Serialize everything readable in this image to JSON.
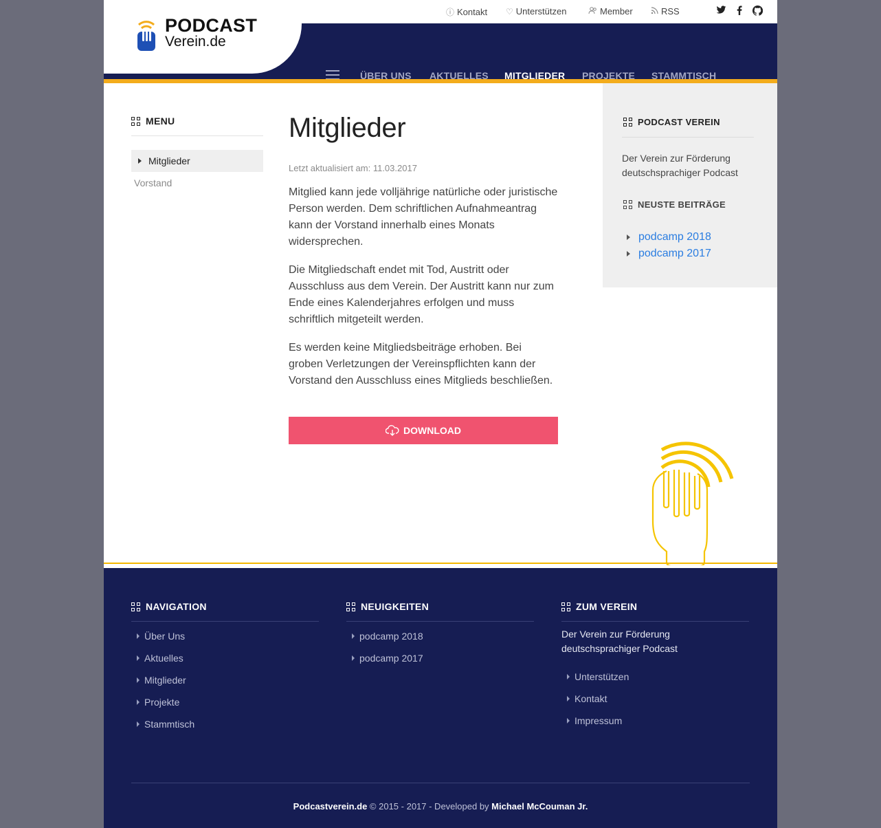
{
  "logo": {
    "title": "PODCAST",
    "subtitle": "Verein.de"
  },
  "topbar": {
    "links": [
      {
        "label": "Kontakt",
        "icon": "question-circle-icon"
      },
      {
        "label": "Unterstützen",
        "icon": "heart-icon"
      },
      {
        "label": "Member",
        "icon": "users-icon"
      },
      {
        "label": "RSS",
        "icon": "rss-icon"
      }
    ],
    "social": [
      "twitter-icon",
      "facebook-icon",
      "github-icon"
    ]
  },
  "nav": {
    "items": [
      "ÜBER UNS",
      "AKTUELLES",
      "MITGLIEDER",
      "PROJEKTE",
      "STAMMTISCH"
    ],
    "active": "MITGLIEDER"
  },
  "left_menu": {
    "title": "MENU",
    "items": [
      "Mitglieder",
      "Vorstand"
    ]
  },
  "main": {
    "title": "Mitglieder",
    "updated": "Letzt aktualisiert am: 11.03.2017",
    "paragraphs": [
      "Mitglied kann jede volljährige natürliche oder juristi­sche Person werden. Dem schriftlichen Aufnahme­antrag kann der Vorstand innerhalb eines Monats widersprechen.",
      "Die Mitgliedschaft endet mit Tod, Austritt oder Ausschluss aus dem Verein. Der Austritt kann nur zum Ende eines Kalenderjahres erfolgen und muss schriftlich mitgeteilt werden.",
      "Es werden keine Mitgliedsbeiträge erhoben. Bei groben Verletzungen der Vereinspflichten kann der Vorstand den Ausschluss eines Mitglieds beschließen."
    ],
    "download_label": "DOWNLOAD"
  },
  "sidebar": {
    "verein_title": "PODCAST VEREIN",
    "verein_desc": "Der Verein zur Förderung deutschsprachiger Podcast",
    "posts_title": "NEUSTE BEITRÄGE",
    "posts": [
      "podcamp 2018",
      "podcamp 2017"
    ]
  },
  "footer": {
    "navigation": {
      "title": "NAVIGATION",
      "links": [
        "Über Uns",
        "Aktuelles",
        "Mitglieder",
        "Projekte",
        "Stammtisch"
      ]
    },
    "news": {
      "title": "NEUIGKEITEN",
      "links": [
        "podcamp 2018",
        "podcamp 2017"
      ]
    },
    "verein": {
      "title": "ZUM VEREIN",
      "desc": "Der Verein zur Förderung deutschsprachiger Podcast",
      "links": [
        "Unterstützen",
        "Kontakt",
        "Impressum"
      ]
    },
    "copyright": {
      "site": "Podcastverein.de",
      "middle": " © 2015 - 2017 - Developed by ",
      "author": "Michael McCouman Jr."
    }
  },
  "colors": {
    "navy": "#161d53",
    "accent": "#f3ac1c",
    "button": "#f0536f",
    "link": "#2a7de1",
    "mascot": "#f5c400"
  }
}
